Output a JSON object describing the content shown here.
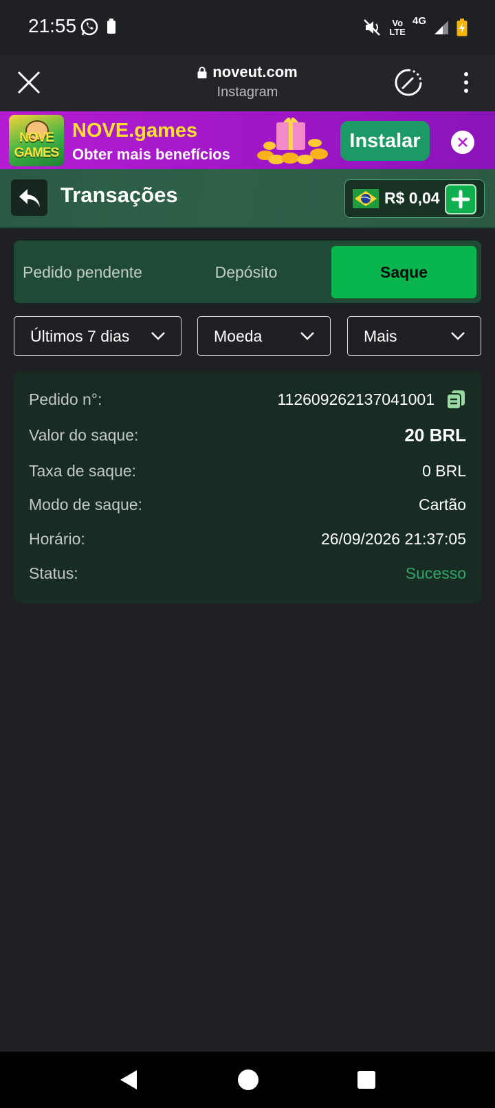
{
  "status_bar": {
    "time": "21:55",
    "network_top": "Vo",
    "network_bottom": "LTE",
    "network_type": "4G",
    "icons": [
      "whatsapp-icon",
      "battery-icon",
      "mute-icon",
      "signal-icon",
      "battery-charging-icon"
    ]
  },
  "browser": {
    "domain": "noveut.com",
    "source": "Instagram",
    "icons": [
      "close-icon",
      "lock-icon",
      "speed-icon",
      "more-vertical-icon"
    ]
  },
  "promo": {
    "logo_text": "NOVE GAMES",
    "title": "NOVE.games",
    "subtitle": "Obter mais benefícios",
    "install_label": "Instalar",
    "colors": {
      "title": "#ffe02e",
      "install": "#1c9a66",
      "banner": "#b41cd3"
    }
  },
  "header": {
    "title": "Transações",
    "balance": "R$ 0,04",
    "icons": [
      "back-icon",
      "brazil-flag-icon",
      "plus-icon"
    ]
  },
  "tabs": [
    {
      "label": "Pedido pendente",
      "active": false
    },
    {
      "label": "Depósito",
      "active": false
    },
    {
      "label": "Saque",
      "active": true
    }
  ],
  "filters": {
    "period": "Últimos 7 dias",
    "currency": "Moeda",
    "more": "Mais"
  },
  "transaction": {
    "order_label": "Pedido n°:",
    "order_value": "112609262137041001",
    "amount_label": "Valor do saque:",
    "amount_value": "20 BRL",
    "fee_label": "Taxa de saque:",
    "fee_value": "0 BRL",
    "mode_label": "Modo de saque:",
    "mode_value": "Cartão",
    "time_label": "Horário:",
    "time_value": "26/09/2026 21:37:05",
    "status_label": "Status:",
    "status_value": "Sucesso",
    "status_color": "#2fa768"
  },
  "nav": {
    "icons": [
      "nav-back-icon",
      "nav-home-icon",
      "nav-recent-icon"
    ]
  }
}
